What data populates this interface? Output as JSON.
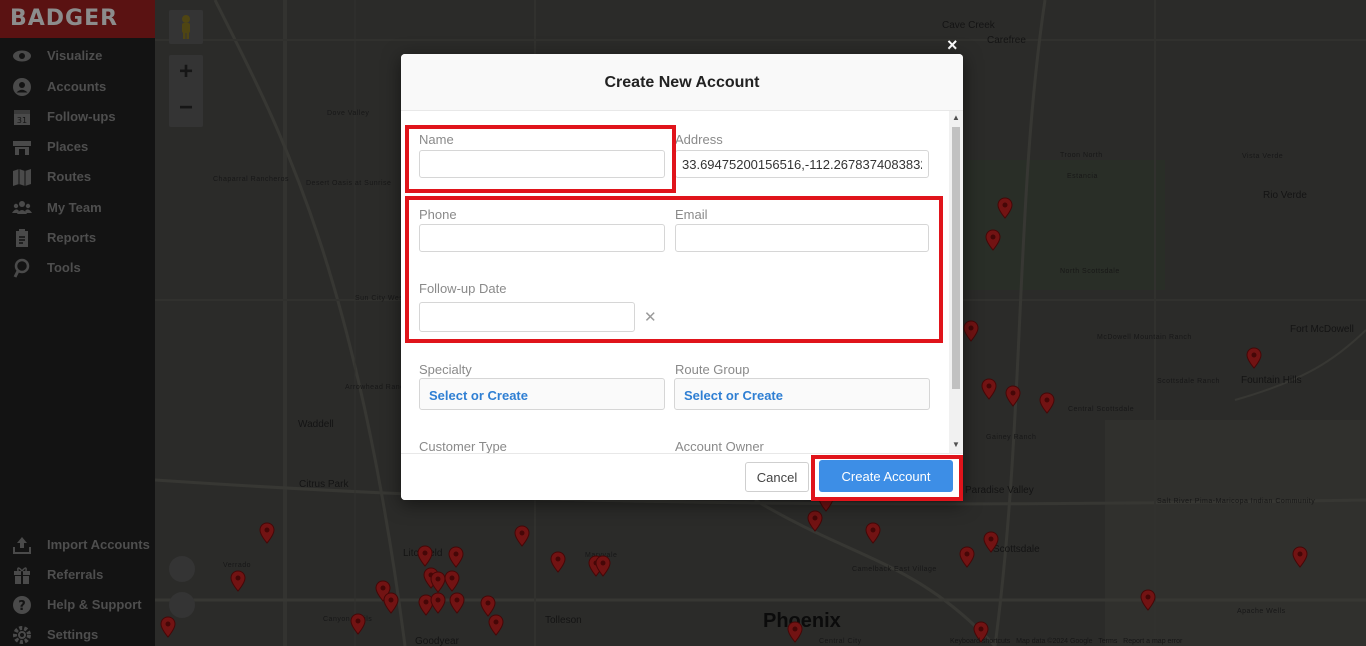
{
  "brand": "BADGER",
  "sidebar": {
    "items": [
      {
        "label": "Visualize",
        "icon": "eye-icon"
      },
      {
        "label": "Accounts",
        "icon": "person-icon"
      },
      {
        "label": "Follow-ups",
        "icon": "calendar-icon"
      },
      {
        "label": "Places",
        "icon": "store-icon"
      },
      {
        "label": "Routes",
        "icon": "map-icon"
      },
      {
        "label": "My Team",
        "icon": "team-icon"
      },
      {
        "label": "Reports",
        "icon": "clipboard-icon"
      },
      {
        "label": "Tools",
        "icon": "tools-icon"
      }
    ],
    "bottom_items": [
      {
        "label": "Import Accounts",
        "icon": "upload-icon"
      },
      {
        "label": "Referrals",
        "icon": "gift-icon"
      },
      {
        "label": "Help & Support",
        "icon": "question-icon"
      },
      {
        "label": "Settings",
        "icon": "gear-icon"
      }
    ]
  },
  "map": {
    "zoom_in": "+",
    "zoom_out": "−",
    "places": [
      "Cave Creek",
      "Carefree",
      "Dove Valley",
      "Chaparral Rancheros",
      "Desert Oasis at Sunrise",
      "Sun City West",
      "Arrowhead Ranch",
      "Estancia",
      "Troon North",
      "North Scottsdale",
      "Fort McDowell",
      "Fountain Hills",
      "McDowell Mountain Ranch",
      "Scottsdale Ranch",
      "Central Scottsdale",
      "Gainey Ranch",
      "Waddell",
      "Citrus Park",
      "Litchfield",
      "Tolleson",
      "Maryvale",
      "Phoenix",
      "Camelback East Village",
      "Central City",
      "Salt River Pima-Maricopa Indian Community",
      "Rio Verde",
      "Vista Verde",
      "Apache Wells",
      "Goodyear",
      "Canyon Trails",
      "Verrado",
      "Paradise Valley",
      "Scottsdale"
    ],
    "footer": [
      "Keyboard shortcuts",
      "Map data ©2024 Google",
      "Terms",
      "Report a map error"
    ]
  },
  "modal": {
    "title": "Create New Account",
    "close": "×",
    "fields": {
      "name": {
        "label": "Name",
        "value": ""
      },
      "address": {
        "label": "Address",
        "value": "33.69475200156516,-112.26783740838326"
      },
      "phone": {
        "label": "Phone",
        "value": ""
      },
      "email": {
        "label": "Email",
        "value": ""
      },
      "followup_date": {
        "label": "Follow-up Date",
        "value": "",
        "clear": "✕"
      },
      "specialty": {
        "label": "Specialty",
        "value": "Select or Create"
      },
      "route_group": {
        "label": "Route Group",
        "value": "Select or Create"
      },
      "customer_type": {
        "label": "Customer Type"
      },
      "account_owner": {
        "label": "Account Owner"
      }
    },
    "cancel_label": "Cancel",
    "create_label": "Create Account"
  },
  "colors": {
    "highlight": "#e0141b",
    "primary": "#3d8ee6",
    "link": "#2f7fd3"
  }
}
